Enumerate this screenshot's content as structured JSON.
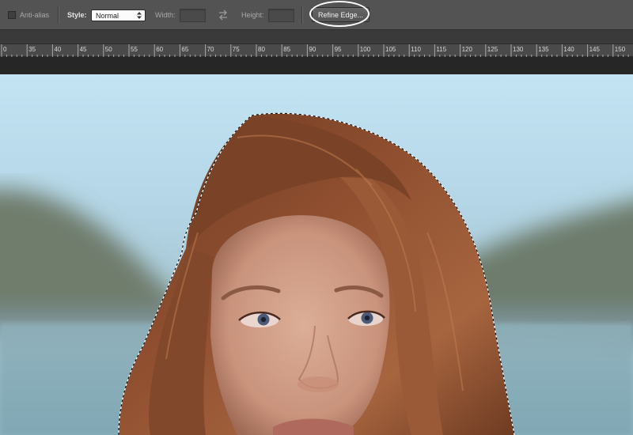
{
  "options_bar": {
    "anti_alias_label": "Anti-alias",
    "style_label": "Style:",
    "style_value": "Normal",
    "width_label": "Width:",
    "height_label": "Height:",
    "refine_edge_label": "Refine Edge..."
  },
  "ruler": {
    "labels": [
      "0",
      "35",
      "40",
      "45",
      "50",
      "55",
      "60",
      "65",
      "70",
      "75",
      "80",
      "85",
      "90",
      "95",
      "100",
      "105",
      "110",
      "115",
      "120",
      "125",
      "130",
      "135",
      "140",
      "145",
      "150"
    ]
  },
  "colors": {
    "options_bar_bg": "#535353",
    "ruler_bg": "#4a4a4a",
    "workspace_bg": "#262626",
    "highlight_ring": "#ffffff"
  },
  "icons": {
    "swap": "swap-arrows-icon",
    "dropdown": "dropdown-arrows-icon"
  }
}
